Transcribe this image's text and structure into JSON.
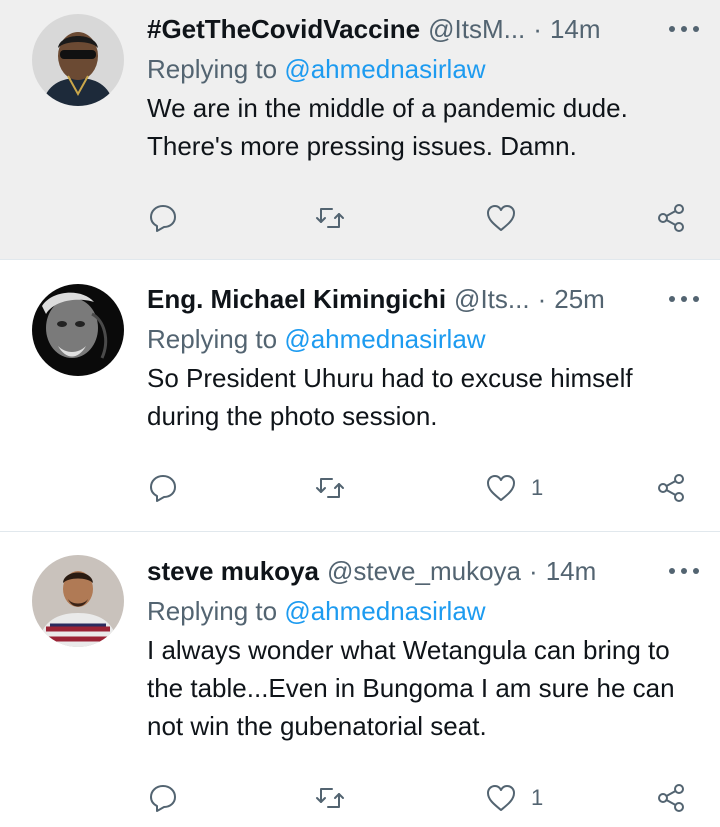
{
  "tweets": [
    {
      "name": "#GetTheCovidVaccine",
      "handle": "@ItsM...",
      "sep": "·",
      "time": "14m",
      "reply_prefix": "Replying to",
      "mention": "@ahmednasirlaw",
      "text": "We are in the middle of a pandemic dude. There's more pressing issues. Damn.",
      "likes": ""
    },
    {
      "name": "Eng. Michael Kimingichi",
      "handle": "@Its...",
      "sep": "·",
      "time": "25m",
      "reply_prefix": "Replying to",
      "mention": "@ahmednasirlaw",
      "text": "So President Uhuru had to excuse himself during the photo session.",
      "likes": "1"
    },
    {
      "name": "steve mukoya",
      "handle": "@steve_mukoya",
      "sep": "·",
      "time": "14m",
      "reply_prefix": "Replying to",
      "mention": "@ahmednasirlaw",
      "text": "I always wonder what Wetangula can bring to the table...Even in Bungoma I am sure he can not win the gubenatorial seat.",
      "likes": "1"
    }
  ],
  "colors": {
    "accent": "#1d9bf0",
    "muted": "#536471",
    "highlight_bg": "#efefef"
  },
  "icons": [
    "more-icon",
    "reply-icon",
    "retweet-icon",
    "like-icon",
    "share-icon"
  ]
}
